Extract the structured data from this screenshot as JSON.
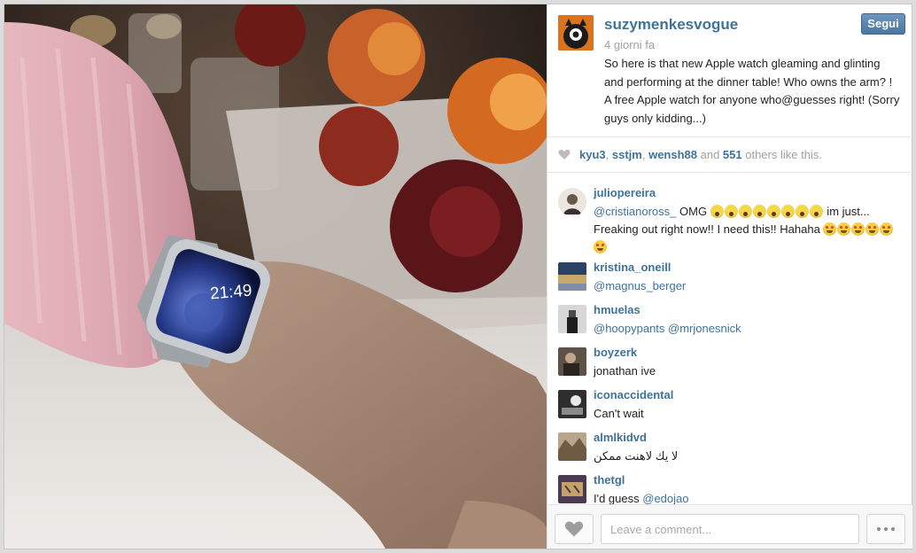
{
  "photo": {
    "watch_time": "21:49"
  },
  "post": {
    "username": "suzymenkesvogue",
    "time": "4 giorni fa",
    "follow_label": "Segui",
    "caption": "So here is that new Apple watch gleaming and glinting and performing at the dinner table! Who owns the arm? ! A free Apple watch for anyone who@guesses right! (Sorry guys only kidding...)"
  },
  "likes": {
    "users": [
      "kyu3",
      "sstjm",
      "wensh88"
    ],
    "sep1": ", ",
    "sep2": ", ",
    "and_label": " and ",
    "others_count": "551",
    "others_label": " others like this."
  },
  "comments": [
    {
      "user": "juliopereira",
      "mention": "@cristianoross_",
      "text_a": " OMG ",
      "text_b": " im just... Freaking out right now!! I need this!! Hahaha ",
      "scream_count": 8,
      "hearteyes_count": 6
    },
    {
      "user": "kristina_oneill",
      "mention": "@magnus_berger",
      "text": ""
    },
    {
      "user": "hmuelas",
      "mention": "@hoopypants @mrjonesnick",
      "text": ""
    },
    {
      "user": "boyzerk",
      "mention": "",
      "text": "jonathan ive"
    },
    {
      "user": "iconaccidental",
      "mention": "",
      "text": "Can't wait"
    },
    {
      "user": "almlkidvd",
      "mention": "",
      "text": "لا يك لاهنت ممكن"
    },
    {
      "user": "thetgl",
      "mention": "@edojao",
      "text": "I'd guess "
    }
  ],
  "comment_bar": {
    "placeholder": "Leave a comment..."
  },
  "icons": {
    "like": "heart-icon",
    "more": "ellipsis-icon"
  }
}
